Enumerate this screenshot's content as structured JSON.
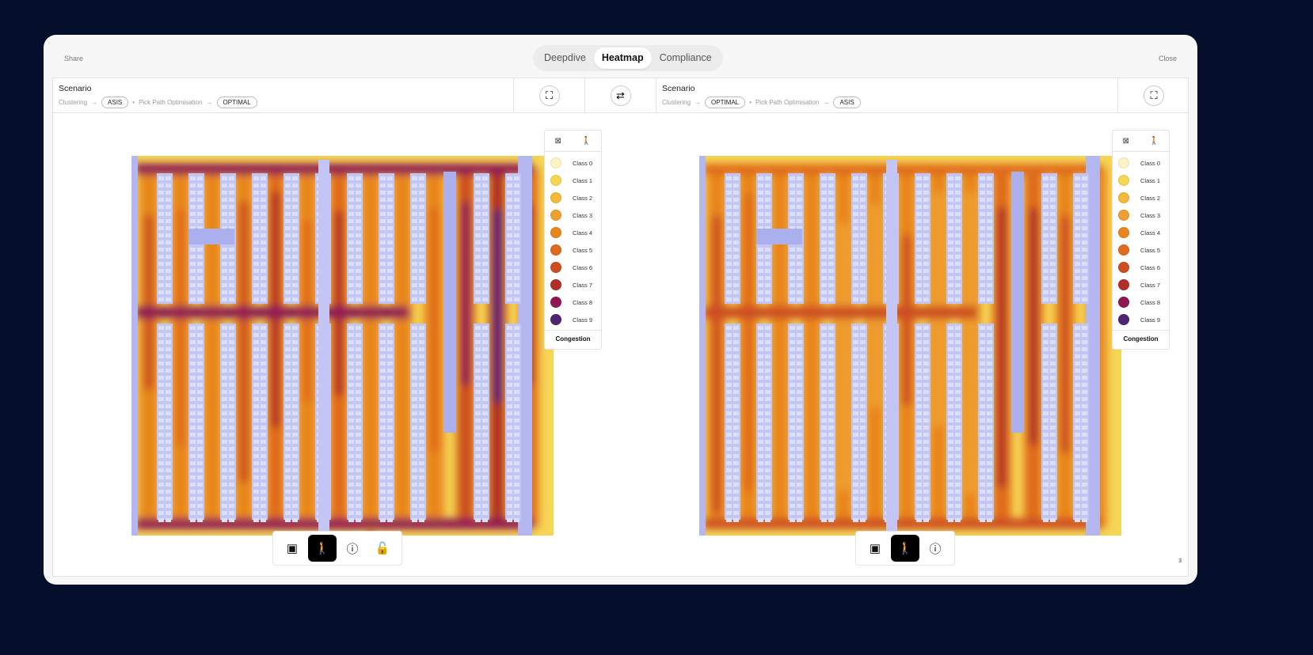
{
  "header": {
    "share": "Share",
    "close": "Close",
    "tabs": [
      "Deepdive",
      "Heatmap",
      "Compliance"
    ],
    "active_tab": "Heatmap"
  },
  "left": {
    "title": "Scenario",
    "clustering_label": "Clustering",
    "clustering_value": "ASIS",
    "sep": "•",
    "path_label": "Pick Path Optimisation",
    "path_value": "OPTIMAL"
  },
  "right": {
    "title": "Scenario",
    "clustering_label": "Clustering",
    "clustering_value": "OPTIMAL",
    "sep": "•",
    "path_label": "Pick Path Optimisation",
    "path_value": "ASIS"
  },
  "icons": {
    "expand": "⛶",
    "swap": "⇄",
    "arrow": "→",
    "map_off": "⊠",
    "walker": "🚶",
    "frame": "▣",
    "info": "ⓘ",
    "unlock": "🔓"
  },
  "legend": {
    "classes": [
      {
        "label": "Class 0",
        "color": "#fdf3c4"
      },
      {
        "label": "Class 1",
        "color": "#f5d655"
      },
      {
        "label": "Class 2",
        "color": "#f3b83a"
      },
      {
        "label": "Class 3",
        "color": "#f0a030"
      },
      {
        "label": "Class 4",
        "color": "#e8851f"
      },
      {
        "label": "Class 5",
        "color": "#e06a1f"
      },
      {
        "label": "Class 6",
        "color": "#cc4e20"
      },
      {
        "label": "Class 7",
        "color": "#b02f28"
      },
      {
        "label": "Class 8",
        "color": "#8f1852"
      },
      {
        "label": "Class 9",
        "color": "#4f2473"
      }
    ],
    "footer": "Congestion"
  },
  "page_number": "3"
}
